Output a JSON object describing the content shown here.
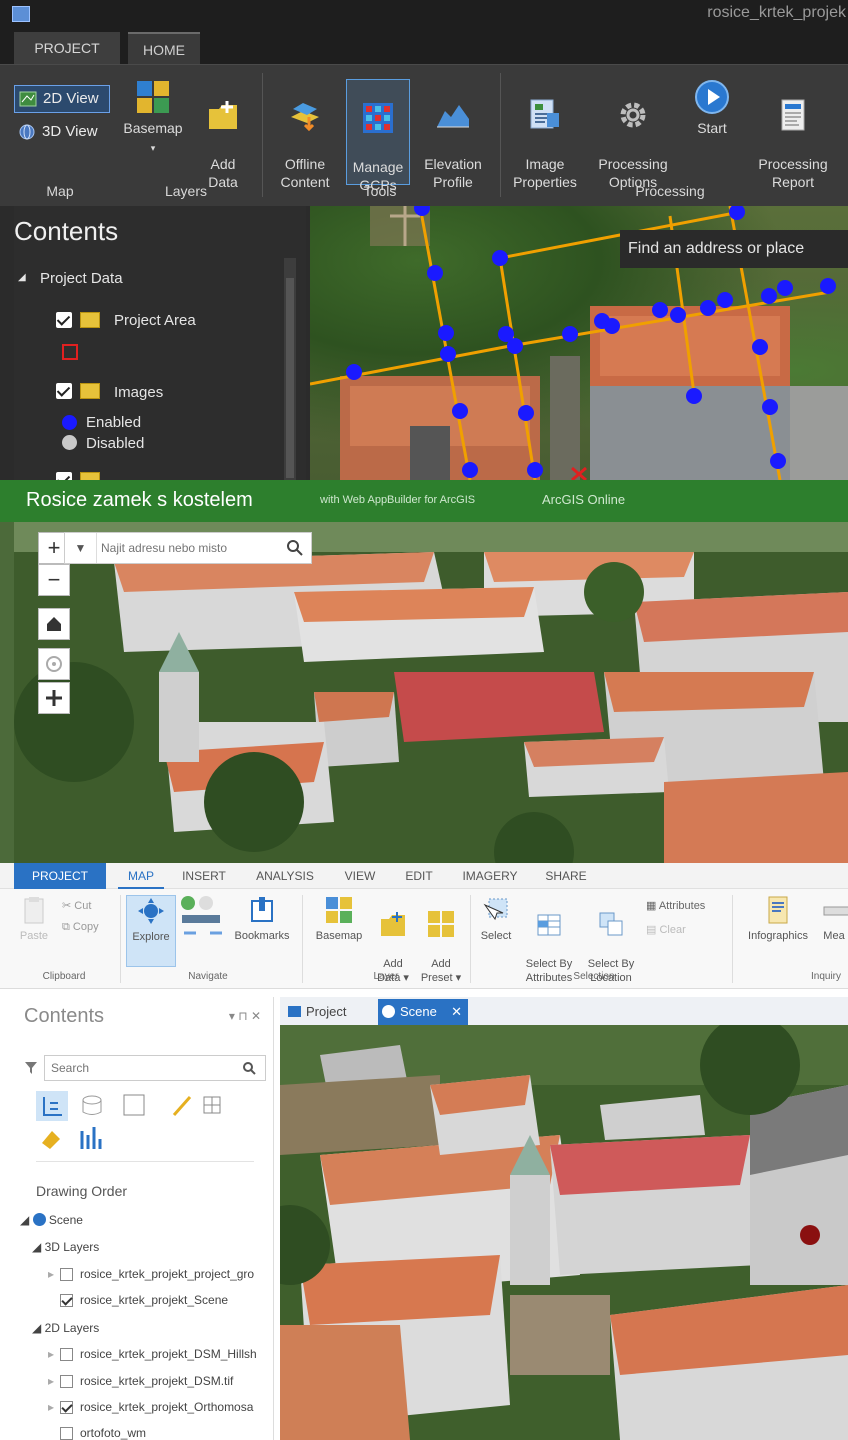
{
  "drone2map": {
    "window_title": "rosice_krtek_projek",
    "tabs": [
      {
        "label": "PROJECT"
      },
      {
        "label": "HOME"
      }
    ],
    "view": {
      "view_2d": "2D View",
      "view_3d": "3D View"
    },
    "buttons": {
      "basemap": "Basemap",
      "add_data": "Add\nData",
      "offline_content": "Offline\nContent",
      "manage_gcps": "Manage\nGCPs",
      "elevation_profile": "Elevation\nProfile",
      "image_properties": "Image\nProperties",
      "processing_options": "Processing\nOptions",
      "start": "Start",
      "processing_report": "Processing\nReport"
    },
    "groups": {
      "map": "Map",
      "layers": "Layers",
      "tools": "Tools",
      "processing": "Processing"
    },
    "contents": {
      "title": "Contents",
      "project_data": "Project Data",
      "project_area": "Project Area",
      "images": "Images",
      "enabled": "Enabled",
      "disabled": "Disabled"
    },
    "map_search": "Find an address or place",
    "colors": {
      "image_point": "#1a1aff",
      "flight_line": "#f0a000",
      "disabled": "#c8c8c8",
      "project_area": "#e02020"
    }
  },
  "webapp": {
    "title": "Rosice zamek s kostelem",
    "subtitle": "with Web AppBuilder for ArcGIS",
    "online": "ArcGIS Online",
    "search_placeholder": "Najit adresu nebo misto",
    "zoom_in": "+",
    "zoom_out": "−",
    "accent": "#2d7f2d"
  },
  "pro": {
    "tabs": [
      {
        "label": "PROJECT"
      },
      {
        "label": "MAP"
      },
      {
        "label": "INSERT"
      },
      {
        "label": "ANALYSIS"
      },
      {
        "label": "VIEW"
      },
      {
        "label": "EDIT"
      },
      {
        "label": "IMAGERY"
      },
      {
        "label": "SHARE"
      }
    ],
    "ribbon": {
      "paste": "Paste",
      "cut": "Cut",
      "copy": "Copy",
      "explore": "Explore",
      "bookmarks": "Bookmarks",
      "basemap": "Basemap",
      "add_data": "Add\nData ▾",
      "add_preset": "Add\nPreset ▾",
      "select": "Select",
      "select_by_attributes": "Select By\nAttributes",
      "select_by_location": "Select By\nLocation",
      "attributes": "Attributes",
      "clear": "Clear",
      "infographics": "Infographics",
      "measure": "Mea"
    },
    "groups": {
      "clipboard": "Clipboard",
      "navigate": "Navigate",
      "layer": "Layer",
      "selection": "Selection",
      "inquiry": "Inquiry"
    },
    "contents": {
      "title": "Contents",
      "controls": "▾ ⊓ ✕",
      "search_placeholder": "Search",
      "drawing_order": "Drawing Order",
      "scene": "Scene",
      "layers_3d": "3D Layers",
      "layer_project_gro": "rosice_krtek_projekt_project_gro",
      "layer_scene": "rosice_krtek_projekt_Scene",
      "layers_2d": "2D Layers",
      "layer_dsm_hillshade": "rosice_krtek_projekt_DSM_Hillsh",
      "layer_dsm_tif": "rosice_krtek_projekt_DSM.tif",
      "layer_ortho": "rosice_krtek_projekt_Orthomosa",
      "layer_ortofoto": "ortofoto_wm"
    },
    "view_tabs": {
      "project": "Project",
      "scene": "Scene",
      "close": "✕"
    },
    "accent": "#2a72c4"
  }
}
